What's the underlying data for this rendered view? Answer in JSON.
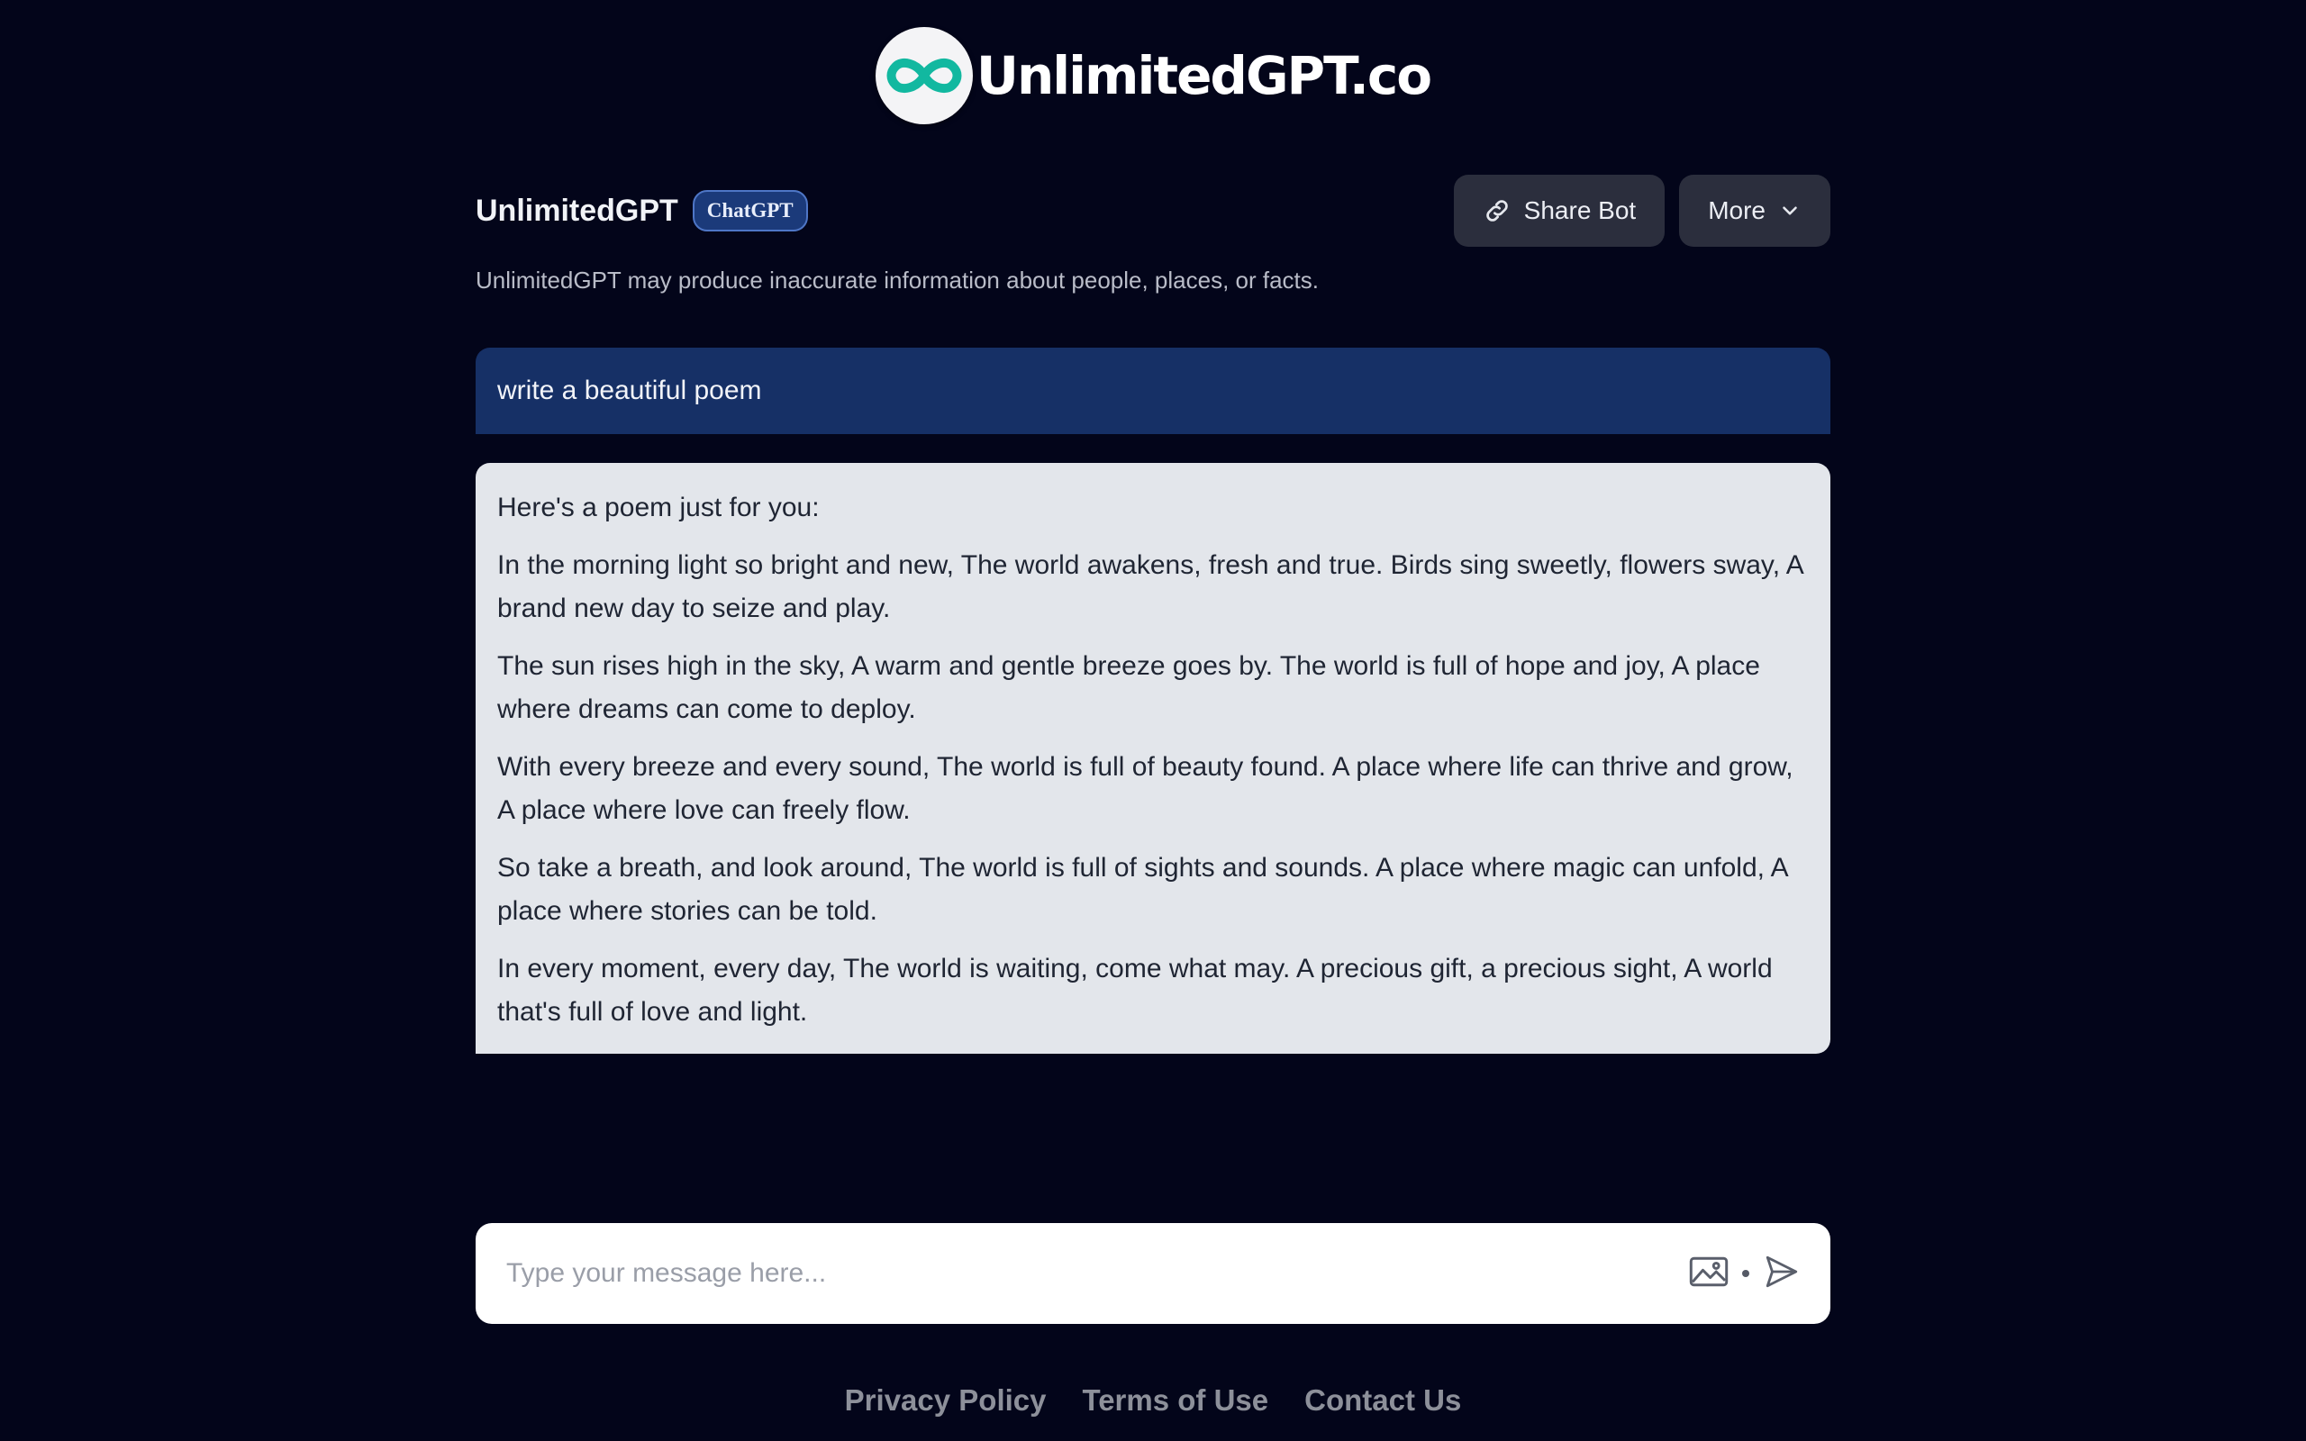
{
  "logo": {
    "text": "UnlimitedGPT.co",
    "mark_color": "#12b8a0"
  },
  "bot": {
    "name": "UnlimitedGPT",
    "badge": "ChatGPT"
  },
  "actions": {
    "share_label": "Share Bot",
    "more_label": "More"
  },
  "disclaimer": "UnlimitedGPT may produce inaccurate information about people, places, or facts.",
  "conversation": {
    "user_message": "write a beautiful poem",
    "bot_paragraphs": [
      "Here's a poem just for you:",
      "In the morning light so bright and new, The world awakens, fresh and true. Birds sing sweetly, flowers sway, A brand new day to seize and play.",
      "The sun rises high in the sky, A warm and gentle breeze goes by. The world is full of hope and joy, A place where dreams can come to deploy.",
      "With every breeze and every sound, The world is full of beauty found. A place where life can thrive and grow, A place where love can freely flow.",
      "So take a breath, and look around, The world is full of sights and sounds. A place where magic can unfold, A place where stories can be told.",
      "In every moment, every day, The world is waiting, come what may. A precious gift, a precious sight, A world that's full of love and light."
    ]
  },
  "composer": {
    "placeholder": "Type your message here...",
    "value": ""
  },
  "footer": {
    "links": [
      "Privacy Policy",
      "Terms of Use",
      "Contact Us"
    ]
  },
  "icons": {
    "logo": "infinity-icon",
    "share": "link-icon",
    "more": "chevron-down-icon",
    "image": "image-icon",
    "send": "send-icon"
  },
  "colors": {
    "background": "#03051a",
    "user_bubble": "#163066",
    "bot_bubble": "#e3e6eb",
    "button": "#2b2e3d",
    "badge": "#1b3a7a"
  }
}
